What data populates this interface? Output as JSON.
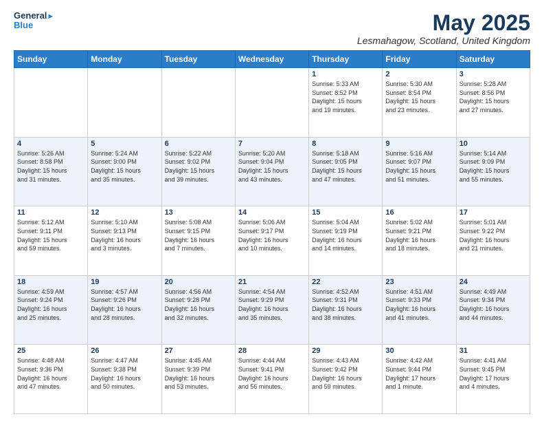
{
  "logo": {
    "line1": "General",
    "line2": "Blue"
  },
  "header": {
    "title": "May 2025",
    "location": "Lesmahagow, Scotland, United Kingdom"
  },
  "weekdays": [
    "Sunday",
    "Monday",
    "Tuesday",
    "Wednesday",
    "Thursday",
    "Friday",
    "Saturday"
  ],
  "weeks": [
    [
      {
        "day": "",
        "content": ""
      },
      {
        "day": "",
        "content": ""
      },
      {
        "day": "",
        "content": ""
      },
      {
        "day": "",
        "content": ""
      },
      {
        "day": "1",
        "content": "Sunrise: 5:33 AM\nSunset: 8:52 PM\nDaylight: 15 hours\nand 19 minutes."
      },
      {
        "day": "2",
        "content": "Sunrise: 5:30 AM\nSunset: 8:54 PM\nDaylight: 15 hours\nand 23 minutes."
      },
      {
        "day": "3",
        "content": "Sunrise: 5:28 AM\nSunset: 8:56 PM\nDaylight: 15 hours\nand 27 minutes."
      }
    ],
    [
      {
        "day": "4",
        "content": "Sunrise: 5:26 AM\nSunset: 8:58 PM\nDaylight: 15 hours\nand 31 minutes."
      },
      {
        "day": "5",
        "content": "Sunrise: 5:24 AM\nSunset: 9:00 PM\nDaylight: 15 hours\nand 35 minutes."
      },
      {
        "day": "6",
        "content": "Sunrise: 5:22 AM\nSunset: 9:02 PM\nDaylight: 15 hours\nand 39 minutes."
      },
      {
        "day": "7",
        "content": "Sunrise: 5:20 AM\nSunset: 9:04 PM\nDaylight: 15 hours\nand 43 minutes."
      },
      {
        "day": "8",
        "content": "Sunrise: 5:18 AM\nSunset: 9:05 PM\nDaylight: 15 hours\nand 47 minutes."
      },
      {
        "day": "9",
        "content": "Sunrise: 5:16 AM\nSunset: 9:07 PM\nDaylight: 15 hours\nand 51 minutes."
      },
      {
        "day": "10",
        "content": "Sunrise: 5:14 AM\nSunset: 9:09 PM\nDaylight: 15 hours\nand 55 minutes."
      }
    ],
    [
      {
        "day": "11",
        "content": "Sunrise: 5:12 AM\nSunset: 9:11 PM\nDaylight: 15 hours\nand 59 minutes."
      },
      {
        "day": "12",
        "content": "Sunrise: 5:10 AM\nSunset: 9:13 PM\nDaylight: 16 hours\nand 3 minutes."
      },
      {
        "day": "13",
        "content": "Sunrise: 5:08 AM\nSunset: 9:15 PM\nDaylight: 16 hours\nand 7 minutes."
      },
      {
        "day": "14",
        "content": "Sunrise: 5:06 AM\nSunset: 9:17 PM\nDaylight: 16 hours\nand 10 minutes."
      },
      {
        "day": "15",
        "content": "Sunrise: 5:04 AM\nSunset: 9:19 PM\nDaylight: 16 hours\nand 14 minutes."
      },
      {
        "day": "16",
        "content": "Sunrise: 5:02 AM\nSunset: 9:21 PM\nDaylight: 16 hours\nand 18 minutes."
      },
      {
        "day": "17",
        "content": "Sunrise: 5:01 AM\nSunset: 9:22 PM\nDaylight: 16 hours\nand 21 minutes."
      }
    ],
    [
      {
        "day": "18",
        "content": "Sunrise: 4:59 AM\nSunset: 9:24 PM\nDaylight: 16 hours\nand 25 minutes."
      },
      {
        "day": "19",
        "content": "Sunrise: 4:57 AM\nSunset: 9:26 PM\nDaylight: 16 hours\nand 28 minutes."
      },
      {
        "day": "20",
        "content": "Sunrise: 4:56 AM\nSunset: 9:28 PM\nDaylight: 16 hours\nand 32 minutes."
      },
      {
        "day": "21",
        "content": "Sunrise: 4:54 AM\nSunset: 9:29 PM\nDaylight: 16 hours\nand 35 minutes."
      },
      {
        "day": "22",
        "content": "Sunrise: 4:52 AM\nSunset: 9:31 PM\nDaylight: 16 hours\nand 38 minutes."
      },
      {
        "day": "23",
        "content": "Sunrise: 4:51 AM\nSunset: 9:33 PM\nDaylight: 16 hours\nand 41 minutes."
      },
      {
        "day": "24",
        "content": "Sunrise: 4:49 AM\nSunset: 9:34 PM\nDaylight: 16 hours\nand 44 minutes."
      }
    ],
    [
      {
        "day": "25",
        "content": "Sunrise: 4:48 AM\nSunset: 9:36 PM\nDaylight: 16 hours\nand 47 minutes."
      },
      {
        "day": "26",
        "content": "Sunrise: 4:47 AM\nSunset: 9:38 PM\nDaylight: 16 hours\nand 50 minutes."
      },
      {
        "day": "27",
        "content": "Sunrise: 4:45 AM\nSunset: 9:39 PM\nDaylight: 16 hours\nand 53 minutes."
      },
      {
        "day": "28",
        "content": "Sunrise: 4:44 AM\nSunset: 9:41 PM\nDaylight: 16 hours\nand 56 minutes."
      },
      {
        "day": "29",
        "content": "Sunrise: 4:43 AM\nSunset: 9:42 PM\nDaylight: 16 hours\nand 59 minutes."
      },
      {
        "day": "30",
        "content": "Sunrise: 4:42 AM\nSunset: 9:44 PM\nDaylight: 17 hours\nand 1 minute."
      },
      {
        "day": "31",
        "content": "Sunrise: 4:41 AM\nSunset: 9:45 PM\nDaylight: 17 hours\nand 4 minutes."
      }
    ]
  ]
}
